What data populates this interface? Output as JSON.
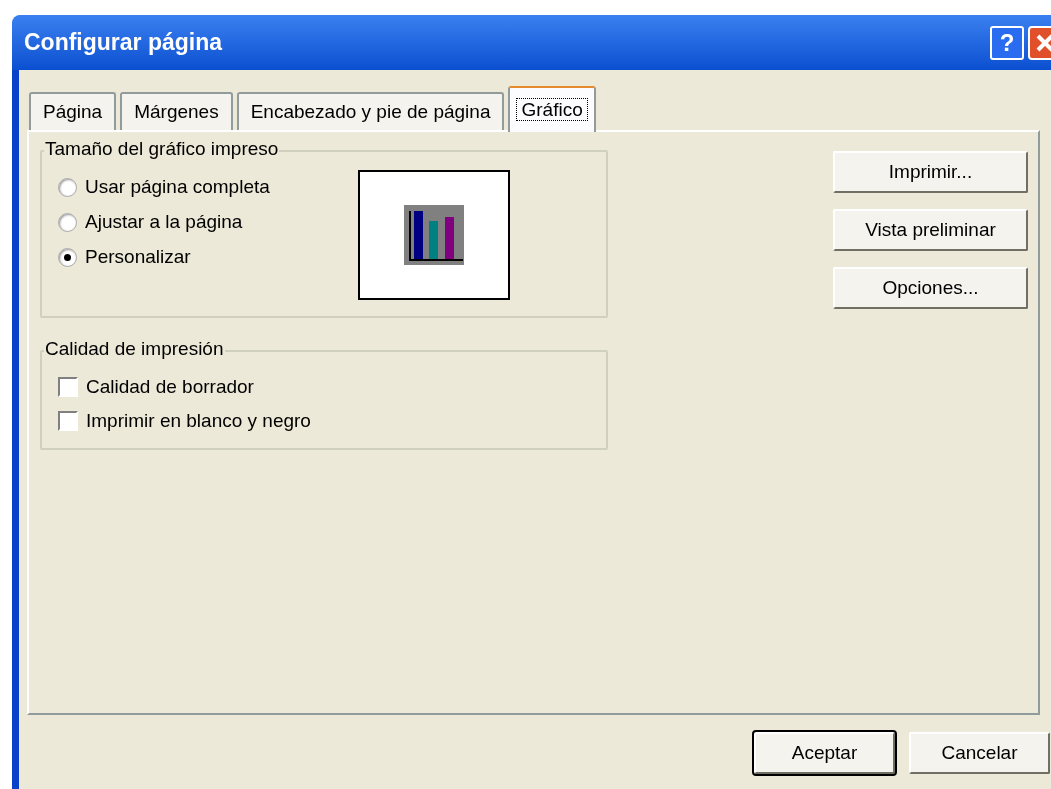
{
  "window": {
    "title": "Configurar página",
    "help_button": "?"
  },
  "tabs": [
    {
      "label": "Página",
      "selected": false
    },
    {
      "label": "Márgenes",
      "selected": false
    },
    {
      "label": "Encabezado y pie de página",
      "selected": false
    },
    {
      "label": "Gráfico",
      "selected": true
    }
  ],
  "size_group": {
    "title": "Tamaño del gráfico impreso",
    "options": [
      {
        "label": "Usar página completa",
        "selected": false
      },
      {
        "label": "Ajustar a la página",
        "selected": false
      },
      {
        "label": "Personalizar",
        "selected": true
      }
    ]
  },
  "quality_group": {
    "title": "Calidad de impresión",
    "options": [
      {
        "label": "Calidad de borrador",
        "checked": false
      },
      {
        "label": "Imprimir en blanco y negro",
        "checked": false
      }
    ]
  },
  "side_buttons": [
    {
      "label": "Imprimir..."
    },
    {
      "label": "Vista preliminar"
    },
    {
      "label": "Opciones..."
    }
  ],
  "footer_buttons": [
    "Aceptar",
    "Cancelar"
  ]
}
